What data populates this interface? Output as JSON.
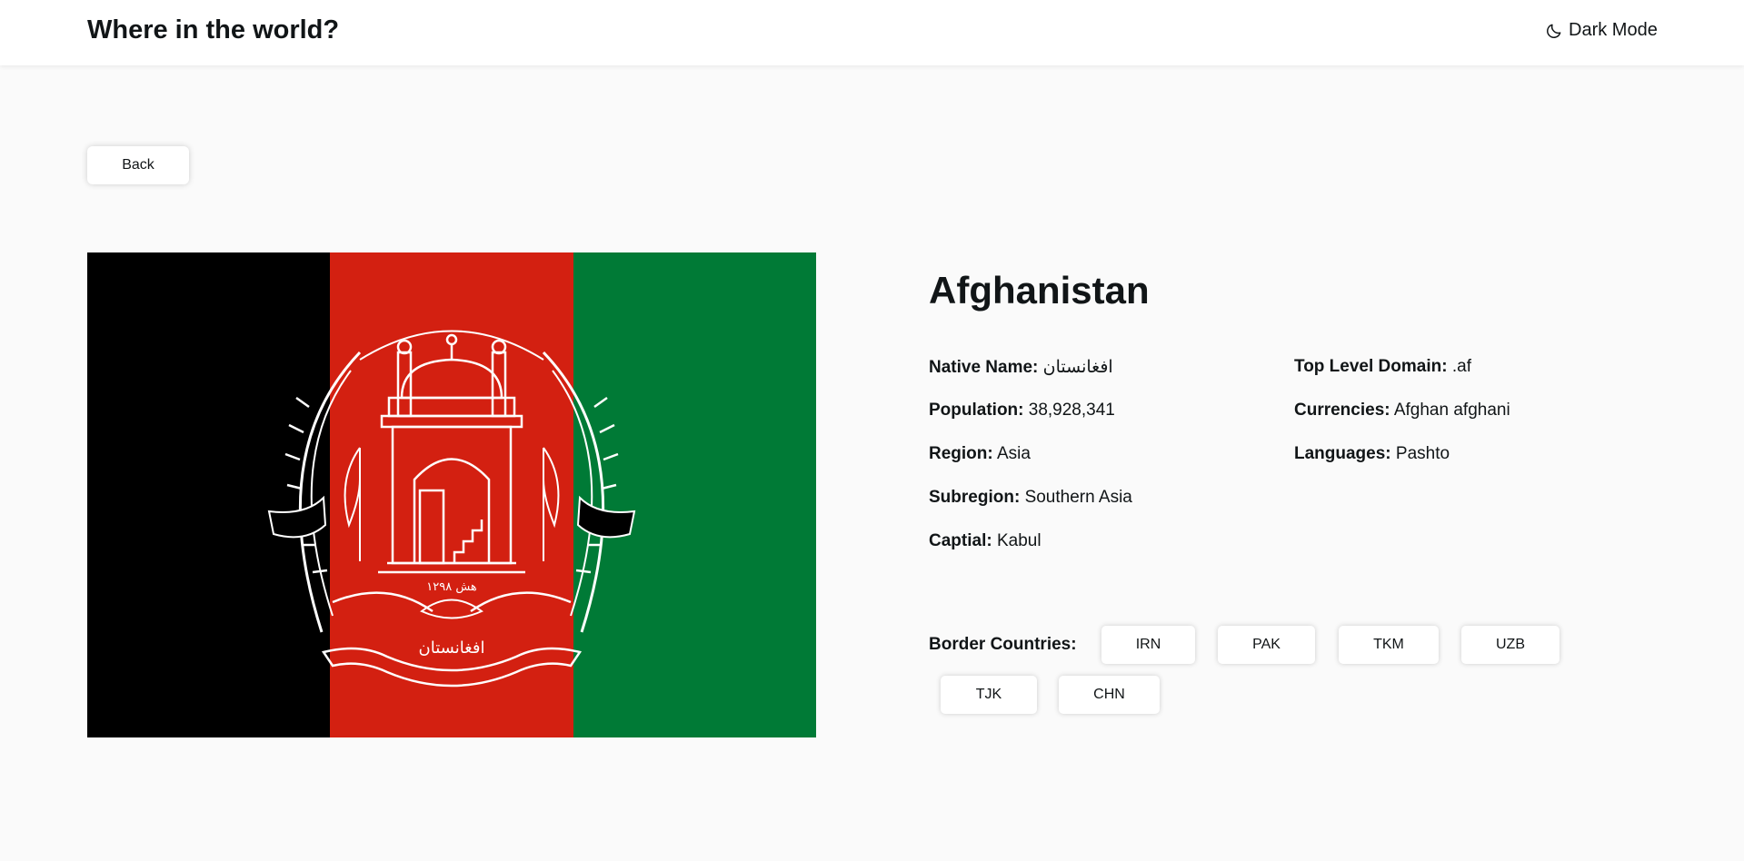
{
  "header": {
    "title": "Where in the world?",
    "theme_toggle_label": "Dark Mode",
    "theme_toggle_icon": "moon-icon"
  },
  "back_label": "Back",
  "country": {
    "name": "Afghanistan",
    "flag": {
      "stripe_colors": [
        "#000000",
        "#d32011",
        "#007a36"
      ],
      "emblem_color": "#ffffff",
      "emblem_year_text": "۱۲۹۸ هش",
      "emblem_name_text": "افغانستان"
    },
    "details_left": [
      {
        "label": "Native Name:",
        "value": "افغانستان"
      },
      {
        "label": "Population:",
        "value": "38,928,341"
      },
      {
        "label": "Region:",
        "value": "Asia"
      },
      {
        "label": "Subregion:",
        "value": "Southern Asia"
      },
      {
        "label": "Captial:",
        "value": "Kabul"
      }
    ],
    "details_right": [
      {
        "label": "Top Level Domain:",
        "value": ".af"
      },
      {
        "label": "Currencies:",
        "value": "Afghan afghani"
      },
      {
        "label": "Languages:",
        "value": "Pashto"
      }
    ],
    "border_label": "Border Countries:",
    "borders": [
      "IRN",
      "PAK",
      "TKM",
      "UZB",
      "TJK",
      "CHN"
    ]
  }
}
